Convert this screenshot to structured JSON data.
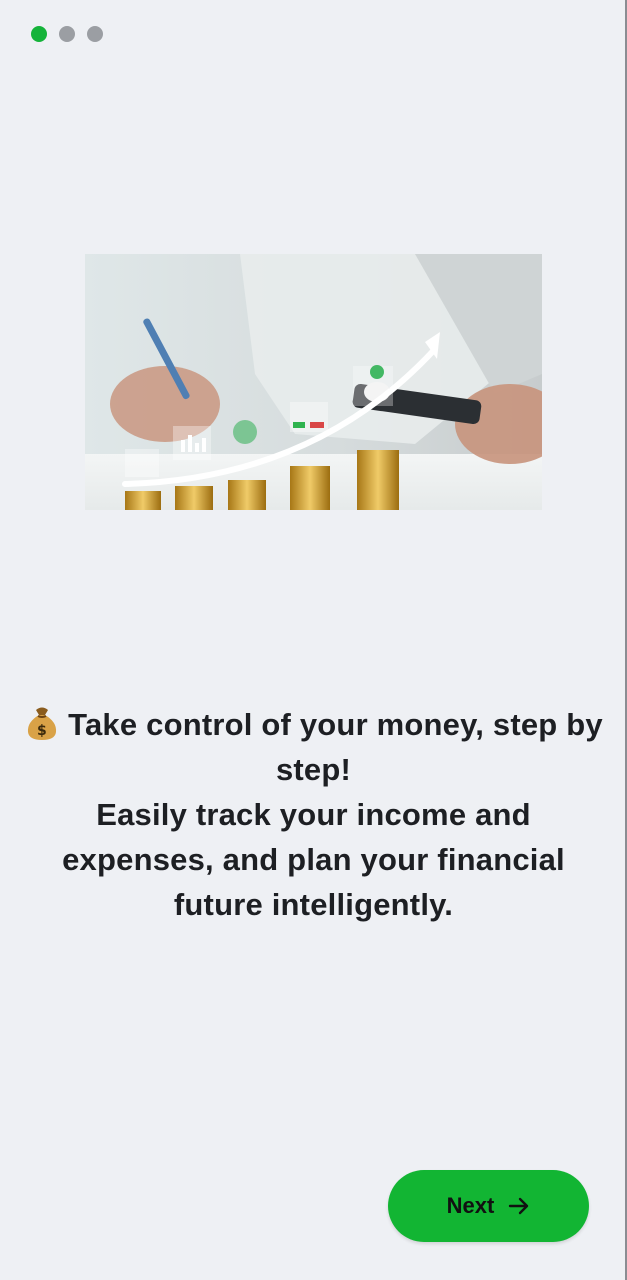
{
  "pager": {
    "total": 3,
    "active_index": 0,
    "colors": {
      "active": "#15b33a",
      "inactive": "#9b9ea3"
    }
  },
  "hero": {
    "icon": "financial-growth-illustration"
  },
  "message": {
    "emoji_icon": "money-bag-icon",
    "line1": "Take control of your money, step by step!",
    "line2": "Easily track your income and expenses, and plan your financial future intelligently."
  },
  "next_button": {
    "label": "Next",
    "icon": "arrow-right-icon",
    "color": "#12b533"
  }
}
